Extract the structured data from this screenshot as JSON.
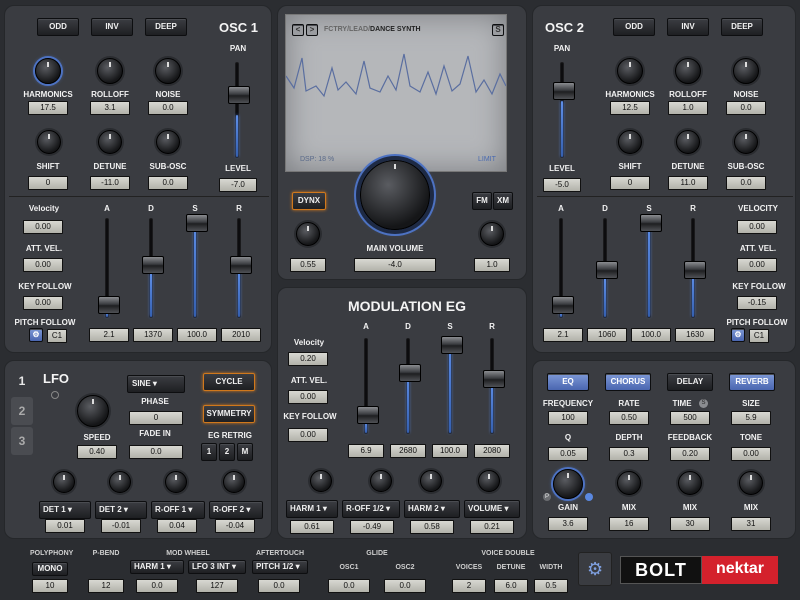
{
  "osc1": {
    "title": "OSC 1",
    "buttons": [
      "ODD",
      "INV",
      "DEEP"
    ],
    "knobs": [
      {
        "label": "HARMONICS",
        "value": "17.5"
      },
      {
        "label": "ROLLOFF",
        "value": "3.1"
      },
      {
        "label": "NOISE",
        "value": "0.0"
      },
      {
        "label": "SHIFT",
        "value": "0"
      },
      {
        "label": "DETUNE",
        "value": "-11.0"
      },
      {
        "label": "SUB-OSC",
        "value": "0.0"
      }
    ],
    "pan_label": "PAN",
    "level_label": "LEVEL",
    "level_value": "-7.0",
    "level_fraction": 0.45,
    "mods": [
      {
        "label": "Velocity",
        "value": "0.00"
      },
      {
        "label": "ATT. VEL.",
        "value": "0.00"
      },
      {
        "label": "KEY FOLLOW",
        "value": "0.00"
      }
    ],
    "pitch_follow": "PITCH FOLLOW",
    "pitch_value": "C1",
    "adsr": [
      {
        "label": "A",
        "value": "2.1",
        "fraction": 0.05
      },
      {
        "label": "D",
        "value": "1370",
        "fraction": 0.45
      },
      {
        "label": "S",
        "value": "100.0",
        "fraction": 1.0
      },
      {
        "label": "R",
        "value": "2010",
        "fraction": 0.5
      }
    ]
  },
  "osc2": {
    "title": "OSC 2",
    "buttons": [
      "ODD",
      "INV",
      "DEEP"
    ],
    "knobs": [
      {
        "label": "HARMONICS",
        "value": "12.5"
      },
      {
        "label": "ROLLOFF",
        "value": "1.0"
      },
      {
        "label": "NOISE",
        "value": "0.0"
      },
      {
        "label": "SHIFT",
        "value": "0"
      },
      {
        "label": "DETUNE",
        "value": "11.0"
      },
      {
        "label": "SUB-OSC",
        "value": "0.0"
      }
    ],
    "pan_label": "PAN",
    "level_label": "LEVEL",
    "level_value": "-5.0",
    "level_fraction": 0.6,
    "mods": [
      {
        "label": "VELOCITY",
        "value": "0.00"
      },
      {
        "label": "ATT. VEL.",
        "value": "0.00"
      },
      {
        "label": "KEY FOLLOW",
        "value": "-0.15"
      }
    ],
    "pitch_follow": "PITCH FOLLOW",
    "pitch_value": "C1",
    "adsr": [
      {
        "label": "A",
        "value": "2.1",
        "fraction": 0.05
      },
      {
        "label": "D",
        "value": "1060",
        "fraction": 0.4
      },
      {
        "label": "S",
        "value": "100.0",
        "fraction": 1.0
      },
      {
        "label": "R",
        "value": "1630",
        "fraction": 0.45
      }
    ]
  },
  "display": {
    "path": "FCTRY/LEAD/",
    "preset": "DANCE SYNTH",
    "s_btn": "S",
    "prev": "<",
    "next": ">",
    "dsp": "DSP: 18 %",
    "limit": "LIMIT"
  },
  "main": {
    "dynx": "DYNX",
    "fm": "FM",
    "xm": "XM",
    "main_volume": "MAIN VOLUME",
    "volume_value": "-4.0",
    "left_value": "0.55",
    "right_value": "1.0"
  },
  "modeg": {
    "title": "MODULATION EG",
    "mods": [
      {
        "label": "Velocity",
        "value": "0.20"
      },
      {
        "label": "ATT. VEL.",
        "value": "0.00"
      },
      {
        "label": "KEY FOLLOW",
        "value": "0.00"
      }
    ],
    "adsr": [
      {
        "label": "A",
        "value": "6.9",
        "fraction": 0.12
      },
      {
        "label": "D",
        "value": "2680",
        "fraction": 0.65
      },
      {
        "label": "S",
        "value": "100.0",
        "fraction": 1.0
      },
      {
        "label": "R",
        "value": "2080",
        "fraction": 0.55
      }
    ],
    "dests": [
      {
        "target": "HARM 1",
        "value": "0.61"
      },
      {
        "target": "R-OFF 1/2",
        "value": "-0.49"
      },
      {
        "target": "HARM 2",
        "value": "0.58"
      },
      {
        "target": "VOLUME",
        "value": "0.21"
      }
    ]
  },
  "lfo": {
    "tabs": [
      "1",
      "2",
      "3"
    ],
    "title": "LFO",
    "wave": "SINE",
    "cycle": "CYCLE",
    "phase_label": "PHASE",
    "phase_value": "0",
    "fade_label": "FADE IN",
    "fade_value": "0.0",
    "speed_label": "SPEED",
    "speed_value": "0.40",
    "symmetry": "SYMMETRY",
    "eg_retrig": "EG RETRIG",
    "retrig": [
      "1",
      "2",
      "M"
    ],
    "dests": [
      {
        "target": "DET 1",
        "value": "0.01"
      },
      {
        "target": "DET 2",
        "value": "-0.01"
      },
      {
        "target": "R-OFF 1",
        "value": "0.04"
      },
      {
        "target": "R-OFF 2",
        "value": "-0.04"
      }
    ]
  },
  "fx": {
    "tabs": [
      "EQ",
      "CHORUS",
      "DELAY",
      "REVERB"
    ],
    "eq": [
      {
        "label": "FREQUENCY",
        "value": "100"
      },
      {
        "label": "Q",
        "value": "0.05"
      },
      {
        "label": "GAIN",
        "value": "3.6"
      }
    ],
    "chorus": [
      {
        "label": "RATE",
        "value": "0.50"
      },
      {
        "label": "DEPTH",
        "value": "0.3"
      },
      {
        "label": "MIX",
        "value": "16"
      }
    ],
    "delay": [
      {
        "label": "TIME",
        "value": "500"
      },
      {
        "label": "FEEDBACK",
        "value": "0.20"
      },
      {
        "label": "MIX",
        "value": "30"
      }
    ],
    "reverb": [
      {
        "label": "SIZE",
        "value": "5.9"
      },
      {
        "label": "TONE",
        "value": "0.00"
      },
      {
        "label": "MIX",
        "value": "31"
      }
    ]
  },
  "bottom": {
    "polyphony": "POLYPHONY",
    "mono": "MONO",
    "poly_value": "10",
    "pbend": "P-BEND",
    "pbend_value": "12",
    "modwheel": "MOD WHEEL",
    "mw1": "HARM 1",
    "mw1_value": "0.0",
    "mw2": "LFO 3 INT",
    "mw2_value": "127",
    "aftertouch": "AFTERTOUCH",
    "at": "PITCH 1/2",
    "at_value": "0.0",
    "glide": "GLIDE",
    "osc1": "OSC1",
    "osc1_value": "0.0",
    "osc2": "OSC2",
    "osc2_value": "0.0",
    "voice_double": "VOICE DOUBLE",
    "voices": "VOICES",
    "voices_value": "2",
    "detune": "DETUNE",
    "detune_value": "6.0",
    "width": "WIDTH",
    "width_value": "0.5"
  },
  "brand": {
    "product": "BOLT",
    "maker": "nektar"
  },
  "colors": {
    "accent": "#5a88e0",
    "brand_red": "#d4212c",
    "orange": "#d0781c"
  }
}
